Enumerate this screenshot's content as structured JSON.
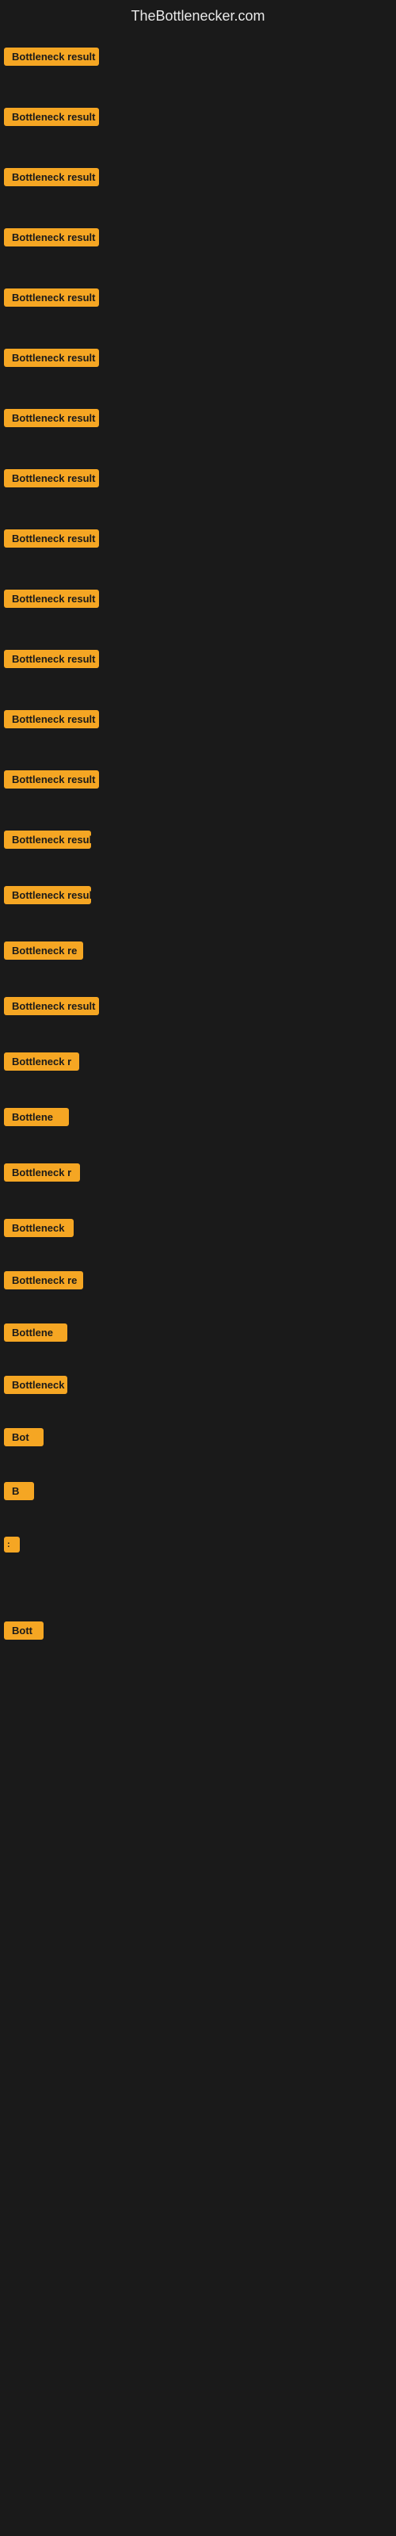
{
  "header": {
    "title": "TheBottlenecker.com"
  },
  "items": [
    {
      "id": 1,
      "label": "Bottleneck result",
      "row_class": "row-1"
    },
    {
      "id": 2,
      "label": "Bottleneck result",
      "row_class": "row-2"
    },
    {
      "id": 3,
      "label": "Bottleneck result",
      "row_class": "row-3"
    },
    {
      "id": 4,
      "label": "Bottleneck result",
      "row_class": "row-4"
    },
    {
      "id": 5,
      "label": "Bottleneck result",
      "row_class": "row-5"
    },
    {
      "id": 6,
      "label": "Bottleneck result",
      "row_class": "row-6"
    },
    {
      "id": 7,
      "label": "Bottleneck result",
      "row_class": "row-7"
    },
    {
      "id": 8,
      "label": "Bottleneck result",
      "row_class": "row-8"
    },
    {
      "id": 9,
      "label": "Bottleneck result",
      "row_class": "row-9"
    },
    {
      "id": 10,
      "label": "Bottleneck result",
      "row_class": "row-10"
    },
    {
      "id": 11,
      "label": "Bottleneck result",
      "row_class": "row-11"
    },
    {
      "id": 12,
      "label": "Bottleneck result",
      "row_class": "row-12"
    },
    {
      "id": 13,
      "label": "Bottleneck result",
      "row_class": "row-13"
    },
    {
      "id": 14,
      "label": "Bottleneck result",
      "row_class": "row-14"
    },
    {
      "id": 15,
      "label": "Bottleneck result",
      "row_class": "row-15"
    },
    {
      "id": 16,
      "label": "Bottleneck re",
      "row_class": "row-16"
    },
    {
      "id": 17,
      "label": "Bottleneck result",
      "row_class": "row-17"
    },
    {
      "id": 18,
      "label": "Bottleneck r",
      "row_class": "row-18"
    },
    {
      "id": 19,
      "label": "Bottlene",
      "row_class": "row-19"
    },
    {
      "id": 20,
      "label": "Bottleneck r",
      "row_class": "row-20"
    },
    {
      "id": 21,
      "label": "Bottleneck",
      "row_class": "row-21"
    },
    {
      "id": 22,
      "label": "Bottleneck re",
      "row_class": "row-22"
    },
    {
      "id": 23,
      "label": "Bottlene",
      "row_class": "row-23"
    },
    {
      "id": 24,
      "label": "Bottleneck",
      "row_class": "row-24"
    },
    {
      "id": 25,
      "label": "Bot",
      "row_class": "row-25"
    },
    {
      "id": 26,
      "label": "B",
      "row_class": "row-26"
    },
    {
      "id": 27,
      "label": ":",
      "row_class": "row-27"
    },
    {
      "id": 28,
      "label": "Bott",
      "row_class": "row-28"
    }
  ],
  "colors": {
    "background": "#1a1a1a",
    "badge_bg": "#f5a623",
    "badge_text": "#1a1a1a",
    "title_text": "#e8e8e8"
  }
}
